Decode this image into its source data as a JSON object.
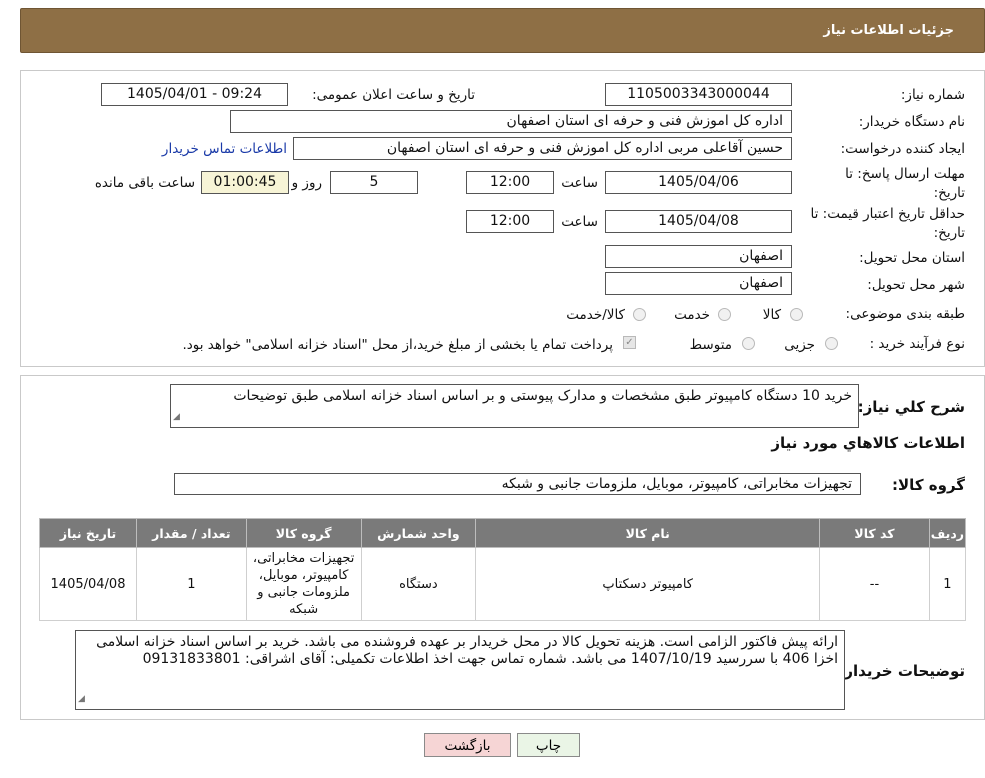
{
  "header": {
    "title": "جزئیات اطلاعات نیاز"
  },
  "form": {
    "need_number_label": "شماره نیاز:",
    "need_number": "1105003343000044",
    "announce_label": "تاریخ و ساعت اعلان عمومی:",
    "announce_value": "1405/04/01 - 09:24",
    "buyer_org_label": "نام دستگاه خریدار:",
    "buyer_org": "اداره کل اموزش فنی و حرفه ای استان اصفهان",
    "creator_label": "ایجاد کننده درخواست:",
    "creator": "حسین آقاعلی مربی اداره کل اموزش فنی و حرفه ای استان اصفهان",
    "contact_link": "اطلاعات تماس خریدار",
    "deadline_label_1": "مهلت ارسال پاسخ: تا",
    "deadline_label_2": "تاریخ:",
    "deadline_date": "1405/04/06",
    "time_label": "ساعت",
    "deadline_time": "12:00",
    "days_value": "5",
    "days_label": "روز و",
    "remaining_time": "01:00:45",
    "remaining_label": "ساعت باقی مانده",
    "validity_label_1": "حداقل تاریخ اعتبار قیمت: تا",
    "validity_label_2": "تاریخ:",
    "validity_date": "1405/04/08",
    "validity_time": "12:00",
    "province_label": "استان محل تحویل:",
    "province": "اصفهان",
    "city_label": "شهر محل تحویل:",
    "city": "اصفهان",
    "category_label": "طبقه بندی موضوعی:",
    "category_options": [
      "کالا",
      "خدمت",
      "کالا/خدمت"
    ],
    "process_label": "نوع فرآیند خرید :",
    "process_options": [
      "جزیی",
      "متوسط"
    ],
    "payment_note": "پرداخت تمام یا بخشی از مبلغ خرید،از محل \"اسناد خزانه اسلامی\" خواهد بود."
  },
  "details": {
    "summary_label": "شرح کلي نياز:",
    "summary": "خرید 10 دستگاه کامپیوتر طبق مشخصات و مدارک پیوستی و بر اساس اسناد خزانه اسلامی طبق توضیحات",
    "goods_info_title": "اطلاعات کالاهاي مورد نياز",
    "goods_group_label": "گروه کالا:",
    "goods_group": "تجهیزات مخابراتی، کامپیوتر، موبایل، ملزومات جانبی و شبکه",
    "table": {
      "headers": [
        "رديف",
        "کد کالا",
        "نام کالا",
        "واحد شمارش",
        "گروه کالا",
        "تعداد / مقدار",
        "تاریخ نیاز"
      ],
      "rows": [
        [
          "1",
          "--",
          "کامپیوتر دسکتاپ",
          "دستگاه",
          "تجهیزات مخابراتی، کامپیوتر، موبایل، ملزومات جانبی و شبکه",
          "1",
          "1405/04/08"
        ]
      ]
    },
    "buyer_notes_label": "توضیحات خریدار:",
    "buyer_notes": "ارائه پیش فاکتور الزامی است. هزینه تحویل کالا در محل خریدار بر عهده فروشنده می باشد. خرید بر اساس اسناد خزانه اسلامی اخزا 406 با سررسید 1407/10/19 می باشد. شماره تماس جهت اخذ اطلاعات تکمیلی:  آقای اشراقی: 09131833801"
  },
  "buttons": {
    "print": "چاپ",
    "back": "بازگشت"
  },
  "colors": {
    "header_bg": "#8e6f45",
    "table_header_bg": "#7a7a7a",
    "back_button_bg": "#f6d5d5",
    "print_button_bg": "#eaf5e6",
    "timer_bg": "#f7f4d6"
  }
}
